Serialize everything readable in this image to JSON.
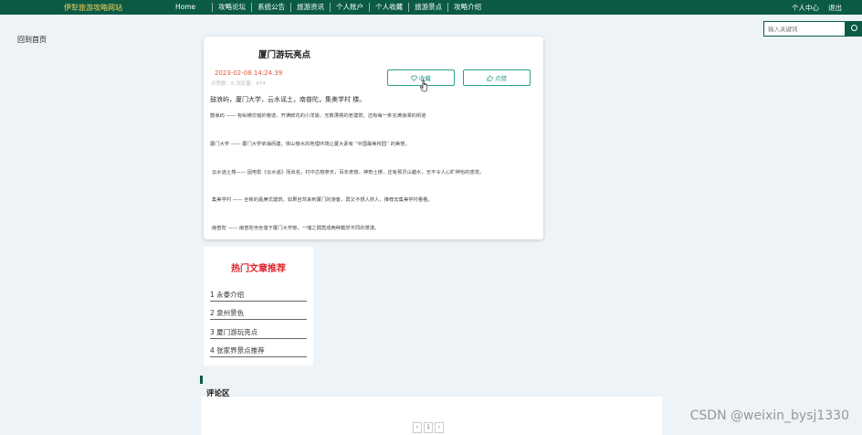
{
  "header": {
    "brand": "伊犁旅游攻略网站",
    "nav": [
      "Home",
      "攻略论坛",
      "系统公告",
      "旅游资讯",
      "个人账户",
      "个人收藏",
      "旅游景点",
      "攻略介绍"
    ],
    "user_center": "个人中心",
    "logout": "退出"
  },
  "search": {
    "placeholder": "输入关键词"
  },
  "back_label": "回到首页",
  "article": {
    "title": "厦门游玩亮点",
    "date": "2023-02-08 14:24:39",
    "meta": "点赞数：0    浏览量：974",
    "fav_label": "收藏",
    "like_label": "点赞",
    "lead": "鼓浪屿，厦门大学，云水谣土，南普陀，集美学村 楼。",
    "paragraphs": [
      "鼓浪屿 —— 有纵横交错的巷道、开满鲜花的小洋房、无数漂亮的老建筑、还有每一条充满浪漫的街道",
      "厦门大学 —— 厦门大学依海而建，依山傍水的地理环境让厦大素有 “中国最美校园” 的美誉。",
      "云水谣土楼—— 因电影《云水谣》而出名，村中古榕参天，百年老榕，神奇土楼，还有那灵山碧水，无不令人心旷神怡的感觉。",
      "集美学村 —— 全新的嘉庚式建筑，如果自驾来到厦门的游客，再又不想人挤人，推荐去集美学村看看。",
      "南普陀 —— 南普陀寺坐落于厦门大学旁，一墙之隔竟成两种截然不同的景境。"
    ]
  },
  "hot": {
    "title": "热门文章推荐",
    "items": [
      "1 永泰介绍",
      "2 泉州景色",
      "3 厦门游玩亮点",
      "4 张家界景点推荐"
    ]
  },
  "comments": {
    "title": "评论区",
    "current_page": "1",
    "prev": "‹",
    "next": "›"
  },
  "watermark": "CSDN @weixin_bysj1330",
  "colors": {
    "nav_bg": "#0a5a46",
    "accent": "#2b9f8a",
    "hot_title": "#e1262f",
    "date": "#e1573a"
  }
}
